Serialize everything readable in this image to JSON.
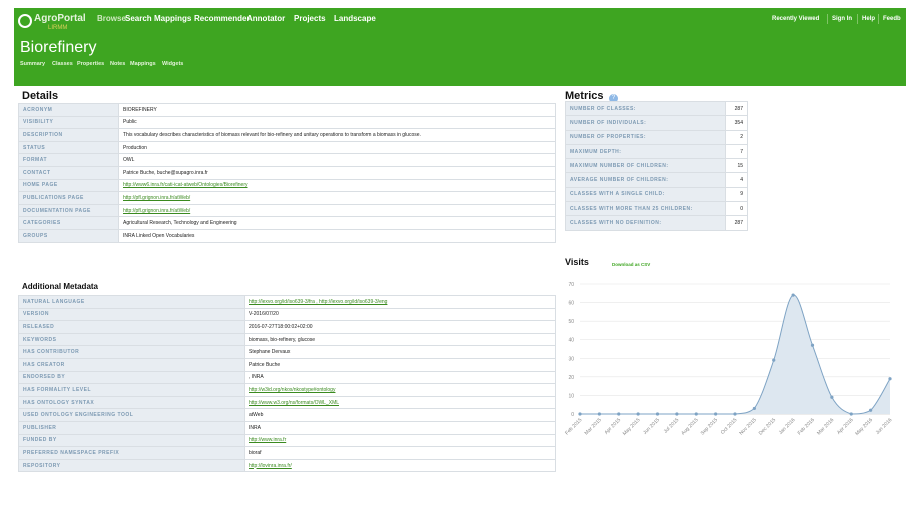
{
  "app": {
    "logo_text": "AgroPortal",
    "logo_sub": "LIRMM"
  },
  "nav": {
    "items": [
      "Browse",
      "Search",
      "Mappings",
      "Recommender",
      "Annotator",
      "Projects",
      "Landscape"
    ],
    "right": [
      "Recently Viewed",
      "Sign In",
      "Help",
      "Feedb"
    ]
  },
  "ontology": {
    "title": "Biorefinery",
    "tabs": [
      "Summary",
      "Classes",
      "Properties",
      "Notes",
      "Mappings",
      "Widgets"
    ]
  },
  "details": {
    "heading": "Details",
    "rows": [
      {
        "k": "ACRONYM",
        "v": "BIOREFINERY",
        "link": false
      },
      {
        "k": "VISIBILITY",
        "v": "Public",
        "link": false
      },
      {
        "k": "DESCRIPTION",
        "v": "This vocabulary describes characteristics of biomass relevant for bio-refinery and unitary operations to transform a biomass in glucose.",
        "link": false
      },
      {
        "k": "STATUS",
        "v": "Production",
        "link": false
      },
      {
        "k": "FORMAT",
        "v": "OWL",
        "link": false
      },
      {
        "k": "CONTACT",
        "v": "Patrice Buche, buche@supagro.inra.fr",
        "link": false
      },
      {
        "k": "HOME PAGE",
        "v": "http://www6.inra.fr/cati-icat-atweb/Ontologies/Biorefinery",
        "link": true
      },
      {
        "k": "PUBLICATIONS PAGE",
        "v": "http://pfl.grignon.inra.fr/atWeb/",
        "link": true
      },
      {
        "k": "DOCUMENTATION PAGE",
        "v": "http://pfl.grignon.inra.fr/atWeb/",
        "link": true
      },
      {
        "k": "CATEGORIES",
        "v": "Agricultural Research, Technology and Engineering",
        "link": false
      },
      {
        "k": "GROUPS",
        "v": "INRA Linked Open Vocabularies",
        "link": false
      }
    ]
  },
  "additional": {
    "heading": "Additional Metadata",
    "rows": [
      {
        "k": "NATURAL LANGUAGE",
        "v": "http://lexvo.org/id/iso639-3/fra , http://lexvo.org/id/iso639-3/eng",
        "link": true
      },
      {
        "k": "VERSION",
        "v": "V-2016/07/20",
        "link": false
      },
      {
        "k": "RELEASED",
        "v": "2016-07-27T18:00:02+02:00",
        "link": false
      },
      {
        "k": "KEYWORDS",
        "v": "biomass, bio-refinery, glucose",
        "link": false
      },
      {
        "k": "HAS CONTRIBUTOR",
        "v": "Stephane Dervaux",
        "link": false
      },
      {
        "k": "HAS CREATOR",
        "v": "Patrice Buche",
        "link": false
      },
      {
        "k": "ENDORSED BY",
        "v": ", INRA",
        "link": false
      },
      {
        "k": "HAS FORMALITY LEVEL",
        "v": "http://w3id.org/nkos/nkostype#ontology",
        "link": true
      },
      {
        "k": "HAS ONTOLOGY SYNTAX",
        "v": "http://www.w3.org/ns/formats/OWL_XML",
        "link": true
      },
      {
        "k": "USED ONTOLOGY ENGINEERING TOOL",
        "v": "atWeb",
        "link": false
      },
      {
        "k": "PUBLISHER",
        "v": "INRA",
        "link": false
      },
      {
        "k": "FUNDED BY",
        "v": "http://www.inra.fr",
        "link": true
      },
      {
        "k": "PREFERRED NAMESPACE PREFIX",
        "v": "bioraf",
        "link": false
      },
      {
        "k": "REPOSITORY",
        "v": "http://lovinra.inra.fr/",
        "link": true
      }
    ]
  },
  "metrics": {
    "heading": "Metrics",
    "help_icon": "?",
    "rows": [
      {
        "k": "NUMBER OF CLASSES:",
        "v": "287"
      },
      {
        "k": "NUMBER OF INDIVIDUALS:",
        "v": "354"
      },
      {
        "k": "NUMBER OF PROPERTIES:",
        "v": "2"
      },
      {
        "k": "MAXIMUM DEPTH:",
        "v": "7"
      },
      {
        "k": "MAXIMUM NUMBER OF CHILDREN:",
        "v": "15"
      },
      {
        "k": "AVERAGE NUMBER OF CHILDREN:",
        "v": "4"
      },
      {
        "k": "CLASSES WITH A SINGLE CHILD:",
        "v": "9"
      },
      {
        "k": "CLASSES WITH MORE THAN 25 CHILDREN:",
        "v": "0"
      },
      {
        "k": "CLASSES WITH NO DEFINITION:",
        "v": "287"
      }
    ]
  },
  "visits": {
    "heading": "Visits",
    "csv_label": "Download as CSV"
  },
  "chart_data": {
    "type": "area",
    "title": "",
    "xlabel": "",
    "ylabel": "",
    "ylim": [
      0,
      70
    ],
    "yticks": [
      0,
      10,
      20,
      30,
      40,
      50,
      60,
      70
    ],
    "grid": true,
    "x": [
      "Feb 2015",
      "Mar 2015",
      "Apr 2015",
      "May 2015",
      "Jun 2015",
      "Jul 2015",
      "Aug 2015",
      "Sep 2015",
      "Oct 2015",
      "Nov 2015",
      "Dec 2015",
      "Jan 2016",
      "Feb 2016",
      "Mar 2016",
      "Apr 2016",
      "May 2016",
      "Jun 2016"
    ],
    "values": [
      0,
      0,
      0,
      0,
      0,
      0,
      0,
      0,
      0,
      3,
      29,
      64,
      37,
      9,
      0,
      2,
      19
    ],
    "color": "#7ea3c4",
    "fill": "#dde7f0"
  }
}
